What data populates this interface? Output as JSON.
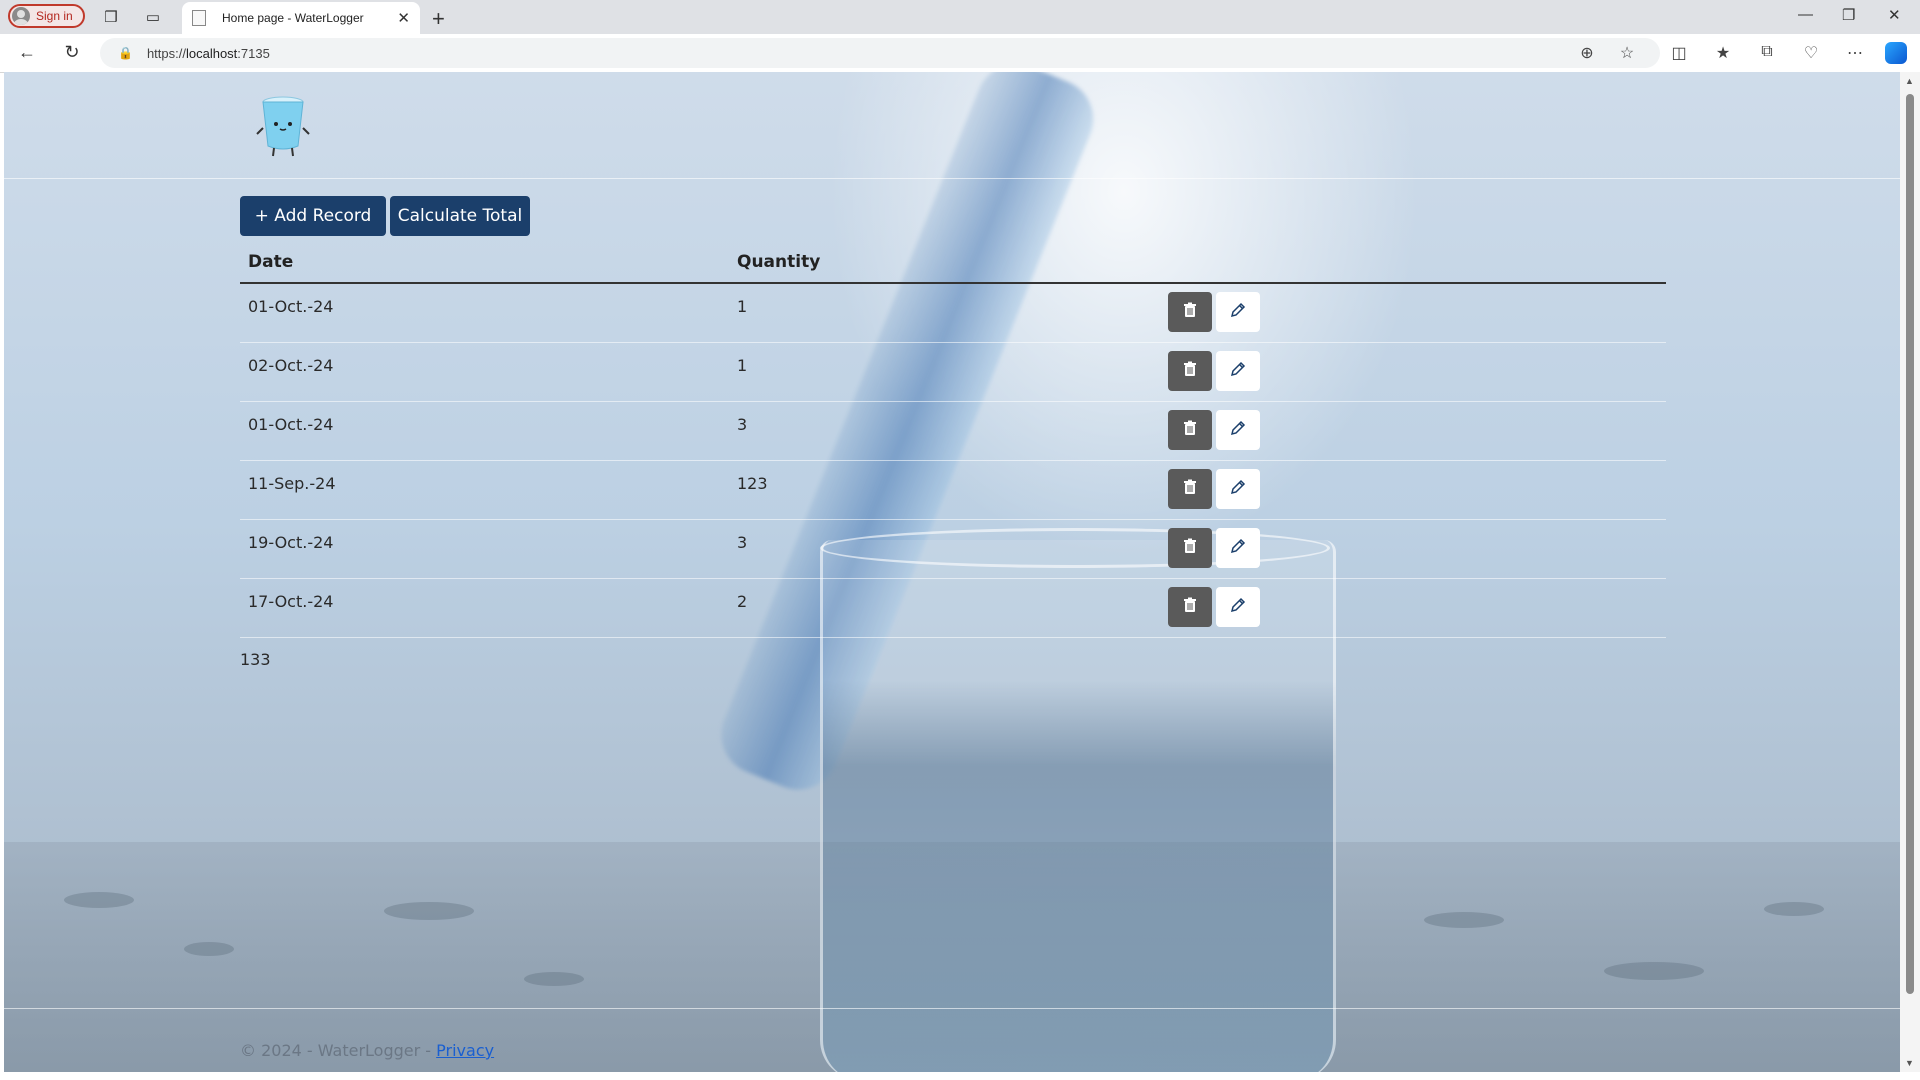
{
  "browser": {
    "signin_label": "Sign in",
    "tab_title": "Home page - WaterLogger",
    "url_scheme": "https://",
    "url_host": "localhost",
    "url_port": ":7135"
  },
  "page": {
    "buttons": {
      "add_record": "+ Add Record",
      "calculate_total": "Calculate Total"
    },
    "table": {
      "headers": [
        "Date",
        "Quantity"
      ],
      "rows": [
        {
          "date": "01-Oct.-24",
          "quantity": "1"
        },
        {
          "date": "02-Oct.-24",
          "quantity": "1"
        },
        {
          "date": "01-Oct.-24",
          "quantity": "3"
        },
        {
          "date": "11-Sep.-24",
          "quantity": "123"
        },
        {
          "date": "19-Oct.-24",
          "quantity": "3"
        },
        {
          "date": "17-Oct.-24",
          "quantity": "2"
        }
      ]
    },
    "total": "133",
    "footer": {
      "copyright": "© 2024 - WaterLogger - ",
      "privacy_link": "Privacy"
    }
  },
  "colors": {
    "primary_button": "#1b3f6b",
    "delete_button": "#5a5a5a",
    "link": "#1a5fd0"
  }
}
